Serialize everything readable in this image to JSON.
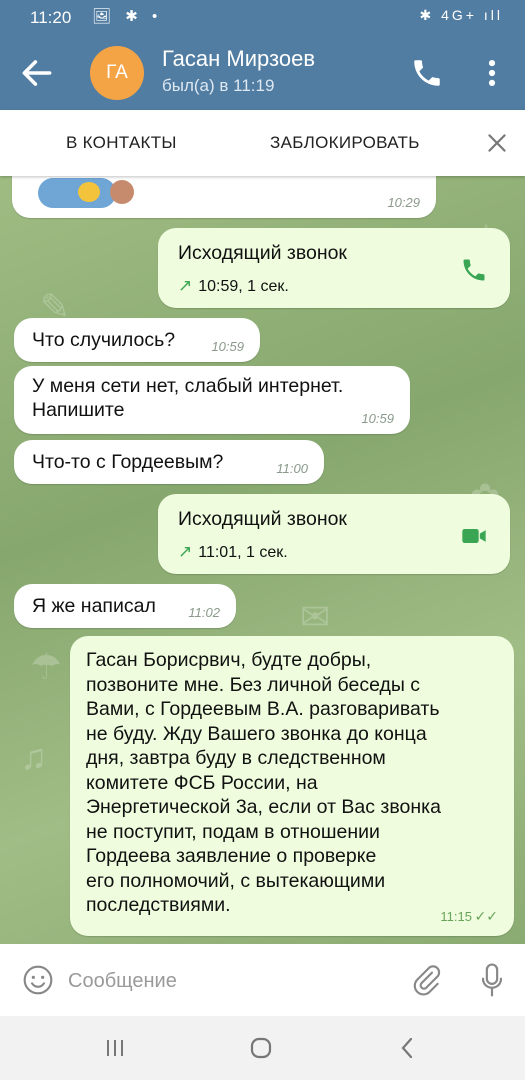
{
  "status_bar": {
    "time": "11:20",
    "left_icons": "🖼 ✱ •",
    "right_icons": "✱ 4G+ ıll"
  },
  "header": {
    "avatar_initials": "ГА",
    "name": "Гасан Мирзоев",
    "last_seen": "был(а) в 11:19",
    "icons": [
      "back-arrow-icon",
      "phone-icon",
      "more-vert-icon"
    ]
  },
  "action_bar": {
    "add_contact": "В КОНТАКТЫ",
    "block": "ЗАБЛОКИРОВАТЬ"
  },
  "messages": [
    {
      "type": "incoming",
      "kind": "emoji",
      "time": "10:29"
    },
    {
      "type": "outgoing",
      "kind": "call",
      "title": "Исходящий звонок",
      "details": "10:59, 1 сек.",
      "icon": "phone-icon"
    },
    {
      "type": "incoming",
      "text": "Что случилось?",
      "time": "10:59"
    },
    {
      "type": "incoming",
      "text": "У меня сети нет, слабый интернет.\nНапишите",
      "time": "10:59"
    },
    {
      "type": "incoming",
      "text": "Что-то с Гордеевым?",
      "time": "11:00"
    },
    {
      "type": "outgoing",
      "kind": "call",
      "title": "Исходящий звонок",
      "details": "11:01, 1 сек.",
      "icon": "video-icon"
    },
    {
      "type": "incoming",
      "text": "Я же написал",
      "time": "11:02"
    },
    {
      "type": "outgoing",
      "text": "Гасан Борисрвич, будте добры,\nпозвоните мне. Без личной беседы с\nВами, с Гордеевым В.А. разговаривать\nне буду. Жду Вашего звонка до конца\nдня, завтра буду в следственном\nкомитете ФСБ России, на\nЭнергетической 3а, если от Вас звонка\nне поступит, подам в отношении\nГордеева заявление о проверке\nего полномочий, с вытекающими\nпоследствиями.",
      "time": "11:15",
      "read": "✓✓"
    }
  ],
  "input": {
    "placeholder": "Сообщение"
  },
  "colors": {
    "header": "#517da2",
    "outgoing_bubble": "#effdde",
    "incoming_bubble": "#ffffff",
    "accent_green": "#3aa653"
  }
}
